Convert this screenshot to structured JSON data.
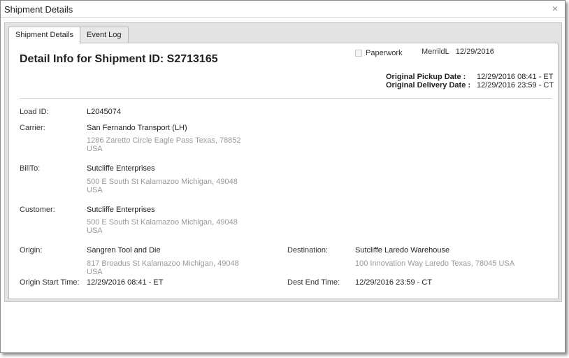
{
  "window": {
    "title": "Shipment Details",
    "close_glyph": "×"
  },
  "tabs": [
    {
      "label": "Shipment Details",
      "active": true
    },
    {
      "label": "Event Log",
      "active": false
    }
  ],
  "header": {
    "title": "Detail Info for Shipment ID: S2713165",
    "paperwork_label": "Paperwork",
    "paperwork_checked": false,
    "user": "MerrildL",
    "user_date": "12/29/2016",
    "pickup_label": "Original Pickup Date   :",
    "pickup_value": "12/29/2016 08:41 - ET",
    "delivery_label": "Original Delivery Date :",
    "delivery_value": "12/29/2016 23:59 - CT"
  },
  "fields": {
    "load_id": {
      "label": "Load ID:",
      "value": "L2045074"
    },
    "carrier": {
      "label": "Carrier:",
      "name": "San Fernando Transport (LH)",
      "address": "1286 Zaretto Circle Eagle Pass Texas, 78852",
      "country": "USA"
    },
    "billto": {
      "label": "BillTo:",
      "name": "Sutcliffe Enterprises",
      "address": "500 E South St Kalamazoo Michigan, 49048",
      "country": "USA"
    },
    "customer": {
      "label": "Customer:",
      "name": "Sutcliffe Enterprises",
      "address": "500 E South St Kalamazoo Michigan, 49048",
      "country": "USA"
    },
    "origin": {
      "label": "Origin:",
      "name": "Sangren Tool and Die",
      "address": "817 Broadus St Kalamazoo Michigan, 49048",
      "country": "USA"
    },
    "destination": {
      "label": "Destination:",
      "name": "Sutcliffe Laredo Warehouse",
      "address": "100 Innovation Way Laredo Texas, 78045 USA"
    },
    "origin_start": {
      "label": "Origin Start Time:",
      "value": "12/29/2016 08:41 - ET"
    },
    "dest_end": {
      "label": "Dest End Time:",
      "value": "12/29/2016 23:59 - CT"
    }
  }
}
